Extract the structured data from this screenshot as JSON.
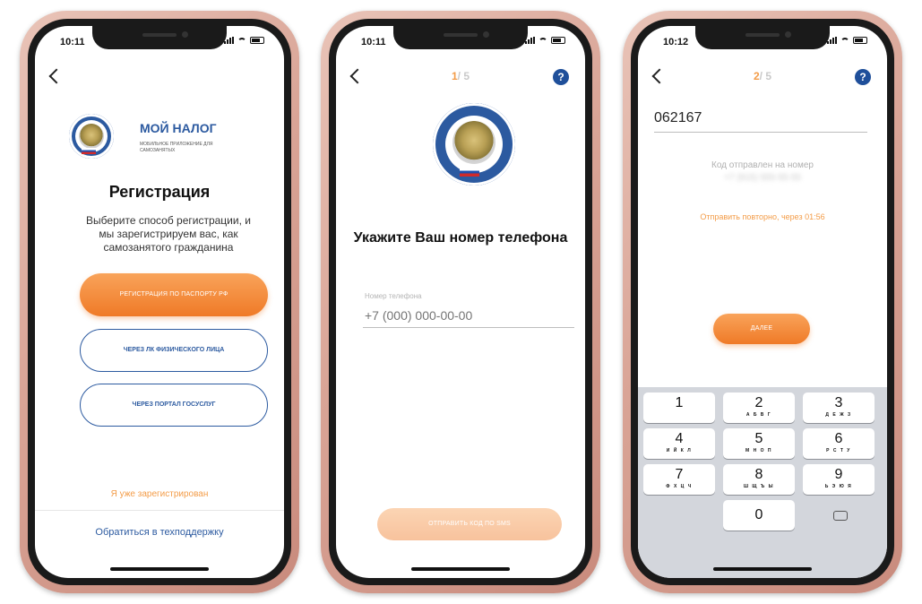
{
  "phone1": {
    "time": "10:11",
    "brand_title": "МОЙ НАЛОГ",
    "brand_subtitle": "МОБИЛЬНОЕ ПРИЛОЖЕНИЕ ДЛЯ САМОЗАНЯТЫХ",
    "heading": "Регистрация",
    "description": "Выберите способ регистрации, и мы зарегистрируем вас, как самозанятого гражданина",
    "btn_passport": "РЕГИСТРАЦИЯ ПО ПАСПОРТУ РФ",
    "btn_lk": "ЧЕРЕЗ ЛК ФИЗИЧЕСКОГО ЛИЦА",
    "btn_gosuslugi": "ЧЕРЕЗ ПОРТАЛ ГОСУСЛУГ",
    "link_registered": "Я уже зарегистрирован",
    "link_support": "Обратиться в техподдержку"
  },
  "phone2": {
    "time": "10:11",
    "step_current": "1",
    "step_total": "/ 5",
    "help": "?",
    "heading": "Укажите Ваш номер телефона",
    "phone_label": "Номер телефона",
    "phone_placeholder": "+7 (000) 000-00-00",
    "btn_send": "ОТПРАВИТЬ КОД ПО SMS"
  },
  "phone3": {
    "time": "10:12",
    "step_current": "2",
    "step_total": "/ 5",
    "help": "?",
    "code_value": "062167",
    "sent_text": "Код отправлен на номер",
    "sent_number": "+7 (915) 555-55-55",
    "resend_text": "Отправить повторно, через 01:56",
    "btn_next": "ДАЛЕЕ",
    "keys": [
      {
        "d": "1",
        "l": ""
      },
      {
        "d": "2",
        "l": "А Б В Г"
      },
      {
        "d": "3",
        "l": "Д Е Ж З"
      },
      {
        "d": "4",
        "l": "И Й К Л"
      },
      {
        "d": "5",
        "l": "М Н О П"
      },
      {
        "d": "6",
        "l": "Р С Т У"
      },
      {
        "d": "7",
        "l": "Ф Х Ц Ч"
      },
      {
        "d": "8",
        "l": "Ш Щ Ъ Ы"
      },
      {
        "d": "9",
        "l": "Ь Э Ю Я"
      },
      {
        "d": "0",
        "l": ""
      }
    ]
  },
  "colors": {
    "accent_orange": "#ef7a27",
    "accent_blue": "#2c5aa0",
    "phone_frame": "#d9a496"
  }
}
